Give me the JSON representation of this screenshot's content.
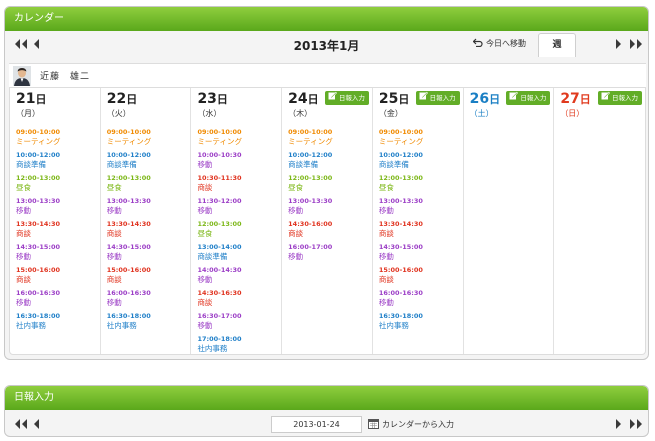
{
  "colors": {
    "header_green": "#6ab82a",
    "orange": "#f08a00",
    "blue": "#1f7fc8",
    "green": "#7cb717",
    "purple": "#9b3dc6",
    "red": "#e0321e",
    "sat_blue": "#1a7fc4",
    "sun_red": "#e03a1e"
  },
  "calendar": {
    "title": "カレンダー",
    "month": "2013年1月",
    "today_label": "今日へ移動",
    "week_tab": "週",
    "user_name": "近藤　雄二",
    "report_label": "日報入力",
    "days": [
      {
        "num": "21",
        "unit": "日",
        "weekday": "（月）",
        "type": "weekday",
        "report": false,
        "events": [
          {
            "time": "09:00-10:00",
            "title": "ミーティング",
            "color": "orange"
          },
          {
            "time": "10:00-12:00",
            "title": "商談準備",
            "color": "blue"
          },
          {
            "time": "12:00-13:00",
            "title": "昼食",
            "color": "green"
          },
          {
            "time": "13:00-13:30",
            "title": "移動",
            "color": "purple"
          },
          {
            "time": "13:30-14:30",
            "title": "商談",
            "color": "red"
          },
          {
            "time": "14:30-15:00",
            "title": "移動",
            "color": "purple"
          },
          {
            "time": "15:00-16:00",
            "title": "商談",
            "color": "red"
          },
          {
            "time": "16:00-16:30",
            "title": "移動",
            "color": "purple"
          },
          {
            "time": "16:30-18:00",
            "title": "社内事務",
            "color": "blue"
          }
        ]
      },
      {
        "num": "22",
        "unit": "日",
        "weekday": "（火）",
        "type": "weekday",
        "report": false,
        "events": [
          {
            "time": "09:00-10:00",
            "title": "ミーティング",
            "color": "orange"
          },
          {
            "time": "10:00-12:00",
            "title": "商談準備",
            "color": "blue"
          },
          {
            "time": "12:00-13:00",
            "title": "昼食",
            "color": "green"
          },
          {
            "time": "13:00-13:30",
            "title": "移動",
            "color": "purple"
          },
          {
            "time": "13:30-14:30",
            "title": "商談",
            "color": "red"
          },
          {
            "time": "14:30-15:00",
            "title": "移動",
            "color": "purple"
          },
          {
            "time": "15:00-16:00",
            "title": "商談",
            "color": "red"
          },
          {
            "time": "16:00-16:30",
            "title": "移動",
            "color": "purple"
          },
          {
            "time": "16:30-18:00",
            "title": "社内事務",
            "color": "blue"
          }
        ]
      },
      {
        "num": "23",
        "unit": "日",
        "weekday": "（水）",
        "type": "weekday",
        "report": false,
        "events": [
          {
            "time": "09:00-10:00",
            "title": "ミーティング",
            "color": "orange"
          },
          {
            "time": "10:00-10:30",
            "title": "移動",
            "color": "purple"
          },
          {
            "time": "10:30-11:30",
            "title": "商談",
            "color": "red"
          },
          {
            "time": "11:30-12:00",
            "title": "移動",
            "color": "purple"
          },
          {
            "time": "12:00-13:00",
            "title": "昼食",
            "color": "green"
          },
          {
            "time": "13:00-14:00",
            "title": "商談準備",
            "color": "blue"
          },
          {
            "time": "14:00-14:30",
            "title": "移動",
            "color": "purple"
          },
          {
            "time": "14:30-16:30",
            "title": "商談",
            "color": "red"
          },
          {
            "time": "16:30-17:00",
            "title": "移動",
            "color": "purple"
          },
          {
            "time": "17:00-18:00",
            "title": "社内事務",
            "color": "blue"
          }
        ]
      },
      {
        "num": "24",
        "unit": "日",
        "weekday": "（木）",
        "type": "weekday",
        "report": true,
        "events": [
          {
            "time": "09:00-10:00",
            "title": "ミーティング",
            "color": "orange"
          },
          {
            "time": "10:00-12:00",
            "title": "商談準備",
            "color": "blue"
          },
          {
            "time": "12:00-13:00",
            "title": "昼食",
            "color": "green"
          },
          {
            "time": "13:00-13:30",
            "title": "移動",
            "color": "purple"
          },
          {
            "time": "14:30-16:00",
            "title": "商談",
            "color": "red"
          },
          {
            "time": "16:00-17:00",
            "title": "移動",
            "color": "purple"
          }
        ]
      },
      {
        "num": "25",
        "unit": "日",
        "weekday": "（金）",
        "type": "weekday",
        "report": true,
        "events": [
          {
            "time": "09:00-10:00",
            "title": "ミーティング",
            "color": "orange"
          },
          {
            "time": "10:00-12:00",
            "title": "商談準備",
            "color": "blue"
          },
          {
            "time": "12:00-13:00",
            "title": "昼食",
            "color": "green"
          },
          {
            "time": "13:00-13:30",
            "title": "移動",
            "color": "purple"
          },
          {
            "time": "13:30-14:30",
            "title": "商談",
            "color": "red"
          },
          {
            "time": "14:30-15:00",
            "title": "移動",
            "color": "purple"
          },
          {
            "time": "15:00-16:00",
            "title": "商談",
            "color": "red"
          },
          {
            "time": "16:00-16:30",
            "title": "移動",
            "color": "purple"
          },
          {
            "time": "16:30-18:00",
            "title": "社内事務",
            "color": "blue"
          }
        ]
      },
      {
        "num": "26",
        "unit": "日",
        "weekday": "（土）",
        "type": "sat",
        "report": true,
        "events": []
      },
      {
        "num": "27",
        "unit": "日",
        "weekday": "（日）",
        "type": "sun",
        "report": true,
        "events": []
      }
    ]
  },
  "daily": {
    "title": "日報入力",
    "date_value": "2013-01-24",
    "calendar_input_label": "カレンダーから入力"
  },
  "icons": {
    "first": "double-left-arrow-icon",
    "prev": "left-arrow-icon",
    "next": "right-arrow-icon",
    "last": "double-right-arrow-icon",
    "today": "undo-arrow-icon",
    "report": "edit-icon",
    "calendar": "calendar-icon",
    "avatar": "user-avatar"
  }
}
